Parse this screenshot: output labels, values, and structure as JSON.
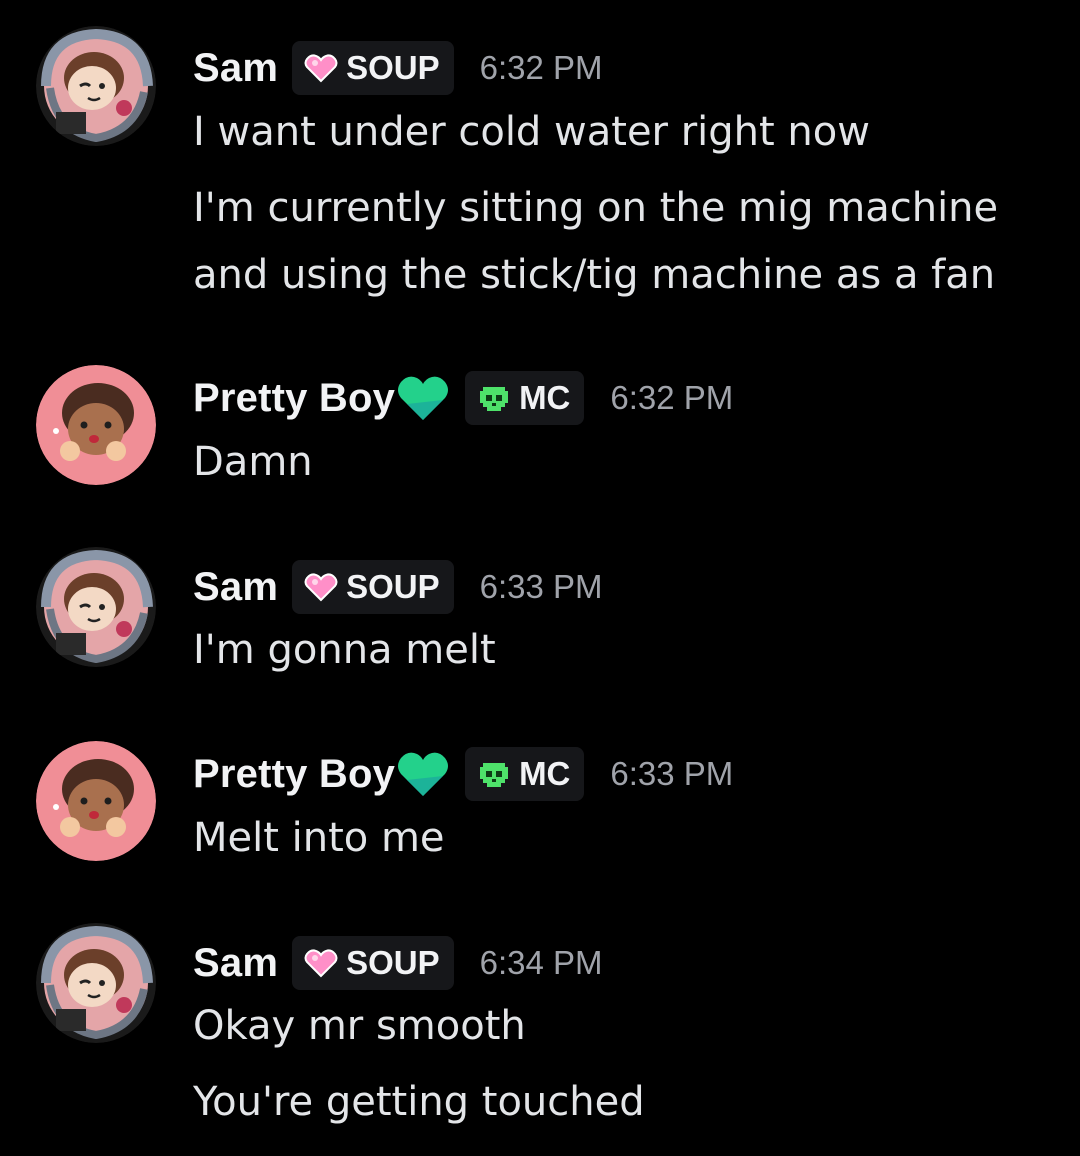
{
  "messages": [
    {
      "author": "Sam",
      "tag": "SOUP",
      "time": "6:32 PM",
      "lines": [
        "I want under cold water right now",
        "I'm currently sitting on the mig machine",
        "and using the stick/tig machine as a fan"
      ]
    },
    {
      "author": "Pretty Boy",
      "tag": "MC",
      "time": "6:32 PM",
      "lines": [
        "Damn"
      ]
    },
    {
      "author": "Sam",
      "tag": "SOUP",
      "time": "6:33 PM",
      "lines": [
        "I'm gonna melt"
      ]
    },
    {
      "author": "Pretty Boy",
      "tag": "MC",
      "time": "6:33 PM",
      "lines": [
        "Melt into me"
      ]
    },
    {
      "author": "Sam",
      "tag": "SOUP",
      "time": "6:34 PM",
      "lines": [
        "Okay mr smooth",
        "You're getting touched"
      ]
    }
  ],
  "icons": {
    "sam_tag_icon": "pink-heart-icon",
    "pretty_boy_tag_icon": "green-skull-icon",
    "pretty_boy_name_emoji": "green-heart-icon"
  },
  "colors": {
    "background": "#000000",
    "username": "#f2f3f5",
    "message_text": "#e3e5e8",
    "timestamp": "#a0a3aa",
    "tag_background": "#16171a",
    "green_heart": "#23d18b",
    "pink_heart": "#ff8fc8",
    "skull_green": "#4ee26a"
  }
}
